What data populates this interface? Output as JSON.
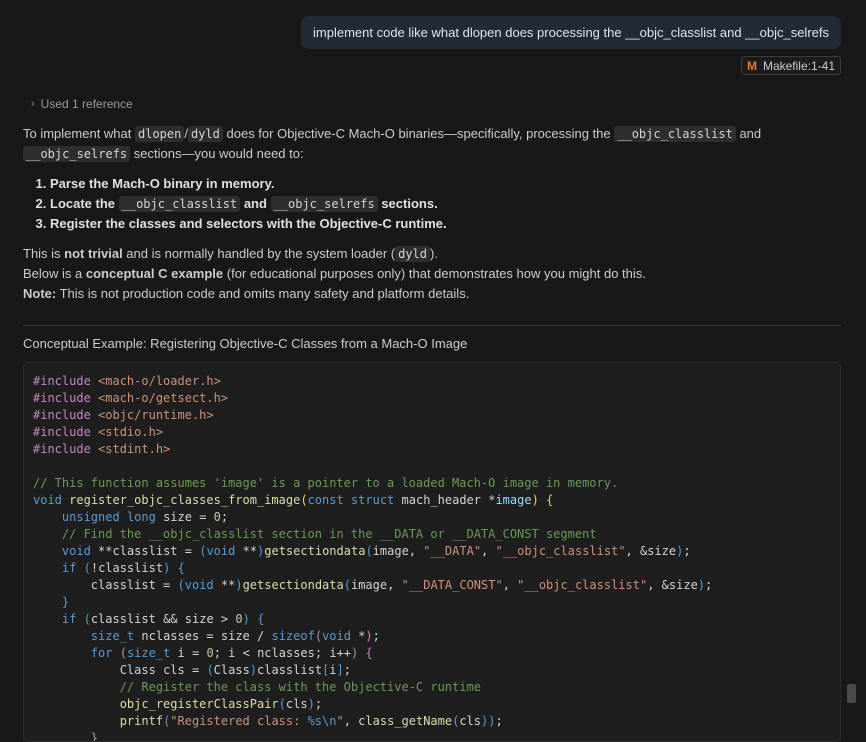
{
  "user_message": "implement code like what dlopen does processing the __objc_classlist and __objc_selrefs",
  "reference_chip": {
    "icon": "makefile-icon",
    "label": "Makefile:1-41"
  },
  "used_references": "Used 1 reference",
  "answer": {
    "intro_1": "To implement what ",
    "intro_code_1": "dlopen",
    "intro_slash": "/",
    "intro_code_2": "dyld",
    "intro_2": " does for Objective-C Mach-O binaries—specifically, processing the ",
    "intro_code_3": "__objc_classlist",
    "intro_3": " and ",
    "intro_code_4": "__objc_selrefs",
    "intro_4": " sections—you would need to:",
    "steps": {
      "s1": "Parse the Mach-O binary in memory.",
      "s2a": "Locate the ",
      "s2code1": "__objc_classlist",
      "s2b": " and ",
      "s2code2": "__objc_selrefs",
      "s2c": " sections.",
      "s3": "Register the classes and selectors with the Objective-C runtime."
    },
    "line1a": "This is ",
    "line1b": "not trivial",
    "line1c": " and is normally handled by the system loader (",
    "line1code": "dyld",
    "line1d": ").",
    "line2a": "Below is a ",
    "line2b": "conceptual C example",
    "line2c": " (for educational purposes only) that demonstrates how you might do this.",
    "line3a": "Note:",
    "line3b": " This is not production code and omits many safety and platform details."
  },
  "example_title": "Conceptual Example: Registering Objective-C Classes from a Mach-O Image",
  "code": {
    "t_include": "#include",
    "h1": "<mach-o/loader.h>",
    "h2": "<mach-o/getsect.h>",
    "h3": "<objc/runtime.h>",
    "h4": "<stdio.h>",
    "h5": "<stdint.h>",
    "c1": "// This function assumes 'image' is a pointer to a loaded Mach-O image in memory.",
    "t_void": "void",
    "f_register": "register_objc_classes_from_image",
    "t_const": "const",
    "t_struct": "struct",
    "ty_mach_header": "mach_header",
    "p_image": "image",
    "t_unsigned": "unsigned",
    "t_long": "long",
    "id_size": "size",
    "n0": "0",
    "c2": "// Find the __objc_classlist section in the __DATA or __DATA_CONST segment",
    "id_classlist": "classlist",
    "f_getsectiondata": "getsectiondata",
    "s_data": "\"__DATA\"",
    "s_classlist": "\"__objc_classlist\"",
    "s_data_const": "\"__DATA_CONST\"",
    "t_if": "if",
    "t_for": "for",
    "t_size_t": "size_t",
    "id_nclasses": "nclasses",
    "f_sizeof": "sizeof",
    "id_i": "i",
    "ty_Class": "Class",
    "id_cls": "cls",
    "c3": "// Register the class with the Objective-C runtime",
    "f_objc_registerClassPair": "objc_registerClassPair",
    "f_printf": "printf",
    "s_registered_a": "\"Registered class: ",
    "s_registered_fmt": "%s\\n",
    "s_registered_b": "\"",
    "f_class_getName": "class_getName"
  }
}
